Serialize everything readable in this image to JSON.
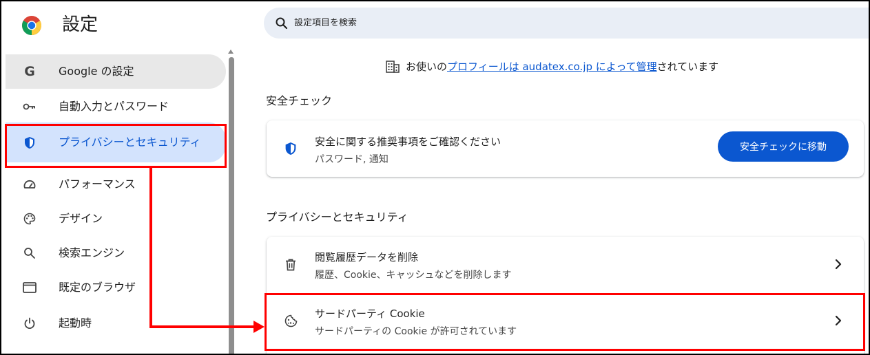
{
  "app": {
    "title": "設定"
  },
  "search": {
    "placeholder": "設定項目を検索"
  },
  "sidebar": {
    "items": [
      {
        "label": "Google の設定"
      },
      {
        "label": "自動入力とパスワード"
      },
      {
        "label": "プライバシーとセキュリティ"
      },
      {
        "label": "パフォーマンス"
      },
      {
        "label": "デザイン"
      },
      {
        "label": "検索エンジン"
      },
      {
        "label": "既定のブラウザ"
      },
      {
        "label": "起動時"
      }
    ]
  },
  "managed": {
    "prefix": "お使いの",
    "link_text": "プロフィールは audatex.co.jp によって管理",
    "suffix": "されています"
  },
  "safety_check": {
    "section_title": "安全チェック",
    "title": "安全に関する推奨事項をご確認ください",
    "subtitle": "パスワード, 通知",
    "button_label": "安全チェックに移動"
  },
  "privacy": {
    "section_title": "プライバシーとセキュリティ",
    "rows": [
      {
        "title": "閲覧履歴データを削除",
        "subtitle": "履歴、Cookie、キャッシュなどを削除します"
      },
      {
        "title": "サードパーティ Cookie",
        "subtitle": "サードパーティの Cookie が許可されています"
      }
    ]
  },
  "colors": {
    "accent": "#0b57d0",
    "active_bg": "#d3e3fd",
    "annotation": "#ff0000"
  }
}
